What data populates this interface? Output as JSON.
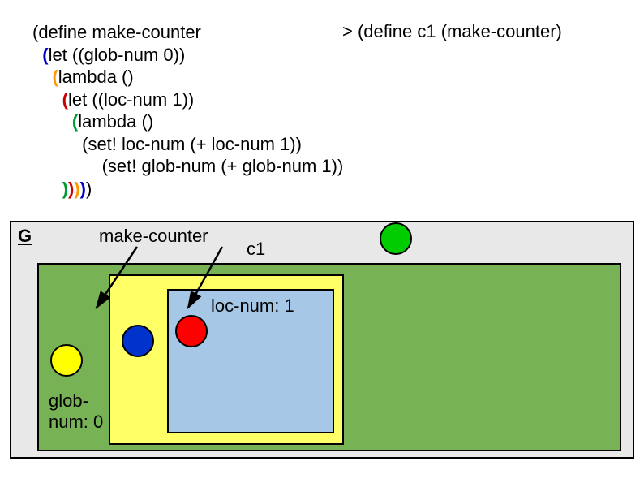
{
  "code": {
    "l1a": "(define make-counter",
    "l2_paren": "  (",
    "l2_rest": "let ((glob-num 0))",
    "l3_paren": "    (",
    "l3_rest": "lambda ()",
    "l4_paren": "      (",
    "l4_rest": "let ((loc-num 1))",
    "l5_paren": "        (",
    "l5_rest": "lambda ()",
    "l6": "          (set! loc-num (+ loc-num 1))",
    "l7": "              (set! glob-num (+ glob-num 1))",
    "l8_a": "      ",
    "l8_p4": ")",
    "l8_p3": ")",
    "l8_p2": ")",
    "l8_p1": ")",
    "l8_p0": ")"
  },
  "repl": "> (define c1 (make-counter)",
  "env": {
    "G": "G",
    "make_counter": "make-counter",
    "c1": "c1",
    "glob_num": "glob-\nnum:\n0",
    "loc_num": "loc-num: 1"
  }
}
